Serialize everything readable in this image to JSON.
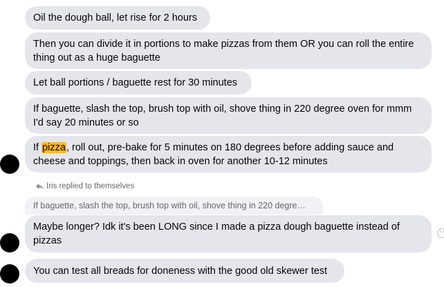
{
  "messages": [
    {
      "text": "Oil the dough ball, let rise for 2 hours"
    },
    {
      "text": "Then you can divide it in portions to make pizzas from them OR you can roll the entire thing out as a huge baguette"
    },
    {
      "text": "Let ball portions / baguette rest for 30 minutes"
    },
    {
      "text": "If baguette, slash the top, brush top with oil, shove thing in 220 degree oven for mmm I'd say 20 minutes or so"
    },
    {
      "text_before": "If ",
      "highlight": "pizza",
      "text_after": ", roll out, pre-bake for 5 minutes on 180 degrees before adding sauce and cheese and toppings, then back in oven for another 10-12 minutes"
    },
    {
      "text": "Maybe longer? Idk it's been LONG since I made a pizza dough baguette instead of pizzas"
    },
    {
      "text": "You can test all breads for doneness with the good old skewer test"
    }
  ],
  "reply": {
    "label": "Iris replied to themselves",
    "quoted": "If baguette, slash the top, brush top with oil, shove thing in 220 degre…"
  },
  "colors": {
    "bubble": "#e4e6eb",
    "highlight": "#f7b928",
    "avatar": "#000000"
  },
  "icons": [
    "reply-arrow-icon",
    "react-smiley-icon"
  ]
}
